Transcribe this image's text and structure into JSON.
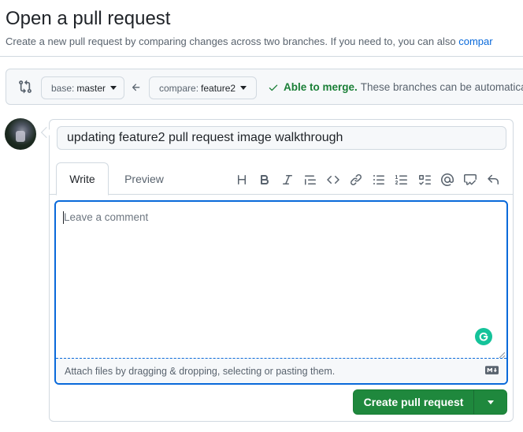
{
  "header": {
    "title": "Open a pull request",
    "subtitle": "Create a new pull request by comparing changes across two branches. If you need to, you can also ",
    "subtitle_link": "compar"
  },
  "range": {
    "base_label": "base:",
    "base_branch": "master",
    "compare_label": "compare:",
    "compare_branch": "feature2",
    "merge_status": "Able to merge.",
    "merge_detail": "These branches can be automatica"
  },
  "form": {
    "title_value": "updating feature2 pull request image walkthrough",
    "tabs": [
      {
        "label": "Write",
        "active": true
      },
      {
        "label": "Preview",
        "active": false
      }
    ],
    "toolbar_icons": [
      "heading-icon",
      "bold-icon",
      "italic-icon",
      "quote-icon",
      "code-icon",
      "link-icon",
      "unordered-list-icon",
      "ordered-list-icon",
      "task-list-icon",
      "mention-icon",
      "reference-icon",
      "undo-icon"
    ],
    "comment_placeholder": "Leave a comment",
    "attach_text": "Attach files by dragging & dropping, selecting or pasting them.",
    "submit_label": "Create pull request"
  },
  "colors": {
    "accent": "#0969da",
    "success": "#1f883d",
    "grammarly": "#15c39a"
  }
}
